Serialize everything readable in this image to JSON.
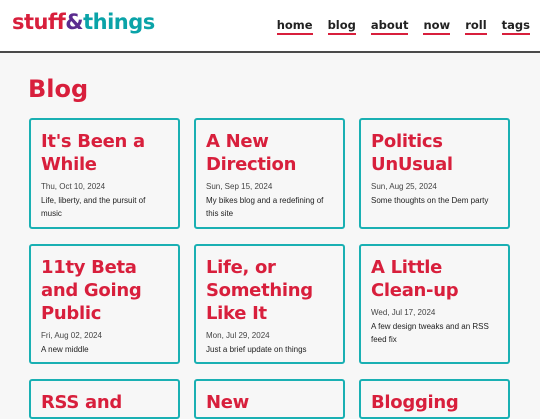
{
  "header": {
    "logo_part1": "stuff",
    "logo_part2": "&",
    "logo_part3": "things",
    "nav": [
      "home",
      "blog",
      "about",
      "now",
      "roll",
      "tags"
    ]
  },
  "page": {
    "title": "Blog"
  },
  "posts": [
    {
      "title": "It's Been a While",
      "date": "Thu, Oct 10, 2024",
      "desc": "Life, liberty, and the pursuit of music"
    },
    {
      "title": "A New Direction",
      "date": "Sun, Sep 15, 2024",
      "desc": "My bikes blog and a redefining of this site"
    },
    {
      "title": "Politics UnUsual",
      "date": "Sun, Aug 25, 2024",
      "desc": "Some thoughts on the Dem party"
    },
    {
      "title": "11ty Beta and Going Public",
      "date": "Fri, Aug 02, 2024",
      "desc": "A new middle"
    },
    {
      "title": "Life, or Something Like It",
      "date": "Mon, Jul 29, 2024",
      "desc": "Just a brief update on things"
    },
    {
      "title": "A Little Clean-up",
      "date": "Wed, Jul 17, 2024",
      "desc": "A few design tweaks and an RSS feed fix"
    },
    {
      "title": "RSS and",
      "date": "",
      "desc": ""
    },
    {
      "title": "New Software",
      "date": "",
      "desc": ""
    },
    {
      "title": "Blogging",
      "date": "",
      "desc": ""
    }
  ],
  "colors": {
    "accent": "#d81f3c",
    "border": "#1ab0b3",
    "purple": "#5b2c8f"
  }
}
